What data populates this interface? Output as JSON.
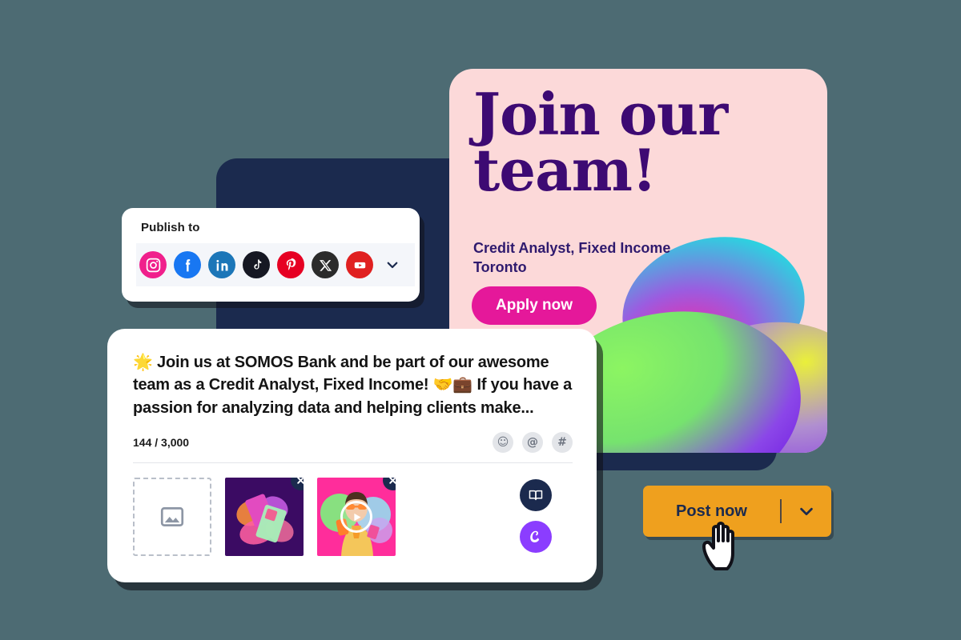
{
  "background_color": "#4d6b73",
  "publish_card": {
    "title": "Publish to",
    "platforms": [
      {
        "name": "instagram",
        "label": "Instagram",
        "color": "#f0208c"
      },
      {
        "name": "facebook",
        "label": "Facebook",
        "color": "#1877f2"
      },
      {
        "name": "linkedin",
        "label": "LinkedIn",
        "color": "#1c76b8"
      },
      {
        "name": "tiktok",
        "label": "TikTok",
        "color": "#161823"
      },
      {
        "name": "pinterest",
        "label": "Pinterest",
        "color": "#e60023"
      },
      {
        "name": "x",
        "label": "X",
        "color": "#2b2b2b"
      },
      {
        "name": "youtube",
        "label": "YouTube",
        "color": "#e02020"
      }
    ],
    "more_icon": "chevron-down-icon"
  },
  "job_card": {
    "headline_line1": "Join our",
    "headline_line2": "team!",
    "role": "Credit Analyst, Fixed Income",
    "location": "Toronto",
    "cta_label": "Apply now",
    "background_color": "#fcd9d9",
    "headline_color": "#3d0a73",
    "cta_color": "#e5189a"
  },
  "composer": {
    "post_text": "🌟 Join us at SOMOS Bank and be part of our awesome team as a Credit Analyst, Fixed Income! 🤝💼 If you have a passion for analyzing data and helping clients make...",
    "char_count": "144 / 3,000",
    "tools": [
      {
        "name": "emoji-icon",
        "glyph": "☺"
      },
      {
        "name": "mention-icon",
        "glyph": "@"
      },
      {
        "name": "hashtag-icon",
        "glyph": "#"
      }
    ],
    "media": [
      {
        "type": "upload-placeholder",
        "label": "Add media"
      },
      {
        "type": "image",
        "label": "Purple cards graphic",
        "removable": true
      },
      {
        "type": "video",
        "label": "Woman with phone video",
        "removable": true
      }
    ],
    "side_actions": [
      {
        "name": "media-library-button",
        "icon": "book-icon",
        "color": "#1b2a4e"
      },
      {
        "name": "canva-button",
        "icon": "canva-icon",
        "color": "#8b3dff"
      }
    ]
  },
  "post_button": {
    "label": "Post now",
    "dropdown_icon": "chevron-down-icon",
    "color": "#efa01e",
    "text_color": "#1b2a4e"
  },
  "cursor": {
    "name": "hand-pointer-cursor"
  }
}
